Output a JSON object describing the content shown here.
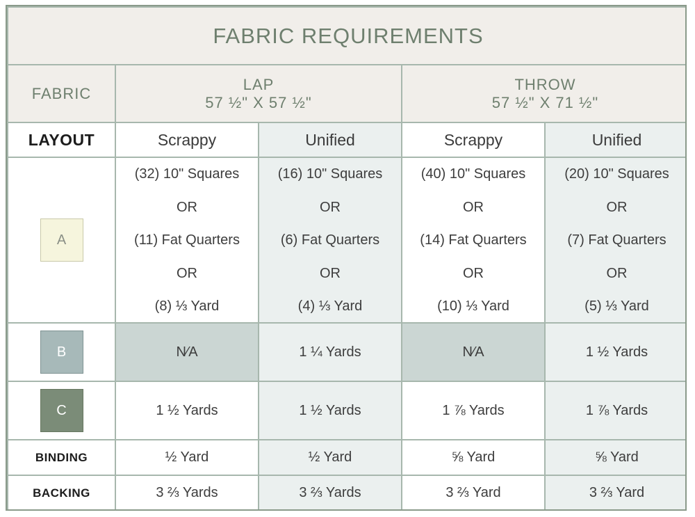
{
  "title": "FABRIC REQUIREMENTS",
  "header": {
    "fabric": "FABRIC",
    "lap": {
      "name": "LAP",
      "size": "57 ½\" X 57 ½\""
    },
    "throw": {
      "name": "THROW",
      "size": "57 ½\" X 71 ½\""
    }
  },
  "layout": {
    "label": "LAYOUT",
    "cols": [
      "Scrappy",
      "Unified",
      "Scrappy",
      "Unified"
    ]
  },
  "fabric_a": {
    "swatch": "A",
    "swatch_color": "#f6f5dd",
    "cols": [
      [
        "(32) 10\" Squares",
        "OR",
        "(11) Fat Quarters",
        "OR",
        "(8) ⅓ Yard"
      ],
      [
        "(16) 10\" Squares",
        "OR",
        "(6) Fat Quarters",
        "OR",
        "(4) ⅓ Yard"
      ],
      [
        "(40) 10\" Squares",
        "OR",
        "(14) Fat Quarters",
        "OR",
        "(10) ⅓ Yard"
      ],
      [
        "(20) 10\" Squares",
        "OR",
        "(7) Fat Quarters",
        "OR",
        "(5) ⅓ Yard"
      ]
    ]
  },
  "fabric_b": {
    "swatch": "B",
    "swatch_color": "#a7b9b9",
    "cols": [
      "N⁄A",
      "1 ¼ Yards",
      "N⁄A",
      "1 ½ Yards"
    ]
  },
  "fabric_c": {
    "swatch": "C",
    "swatch_color": "#7b8c78",
    "cols": [
      "1 ½ Yards",
      "1 ½ Yards",
      "1 ⅞ Yards",
      "1 ⅞ Yards"
    ]
  },
  "binding": {
    "label": "BINDING",
    "cols": [
      "½ Yard",
      "½ Yard",
      "⅝ Yard",
      "⅝ Yard"
    ]
  },
  "backing": {
    "label": "BACKING",
    "cols": [
      "3 ⅔ Yards",
      "3 ⅔ Yards",
      "3 ⅔ Yard",
      "3 ⅔ Yard"
    ]
  }
}
